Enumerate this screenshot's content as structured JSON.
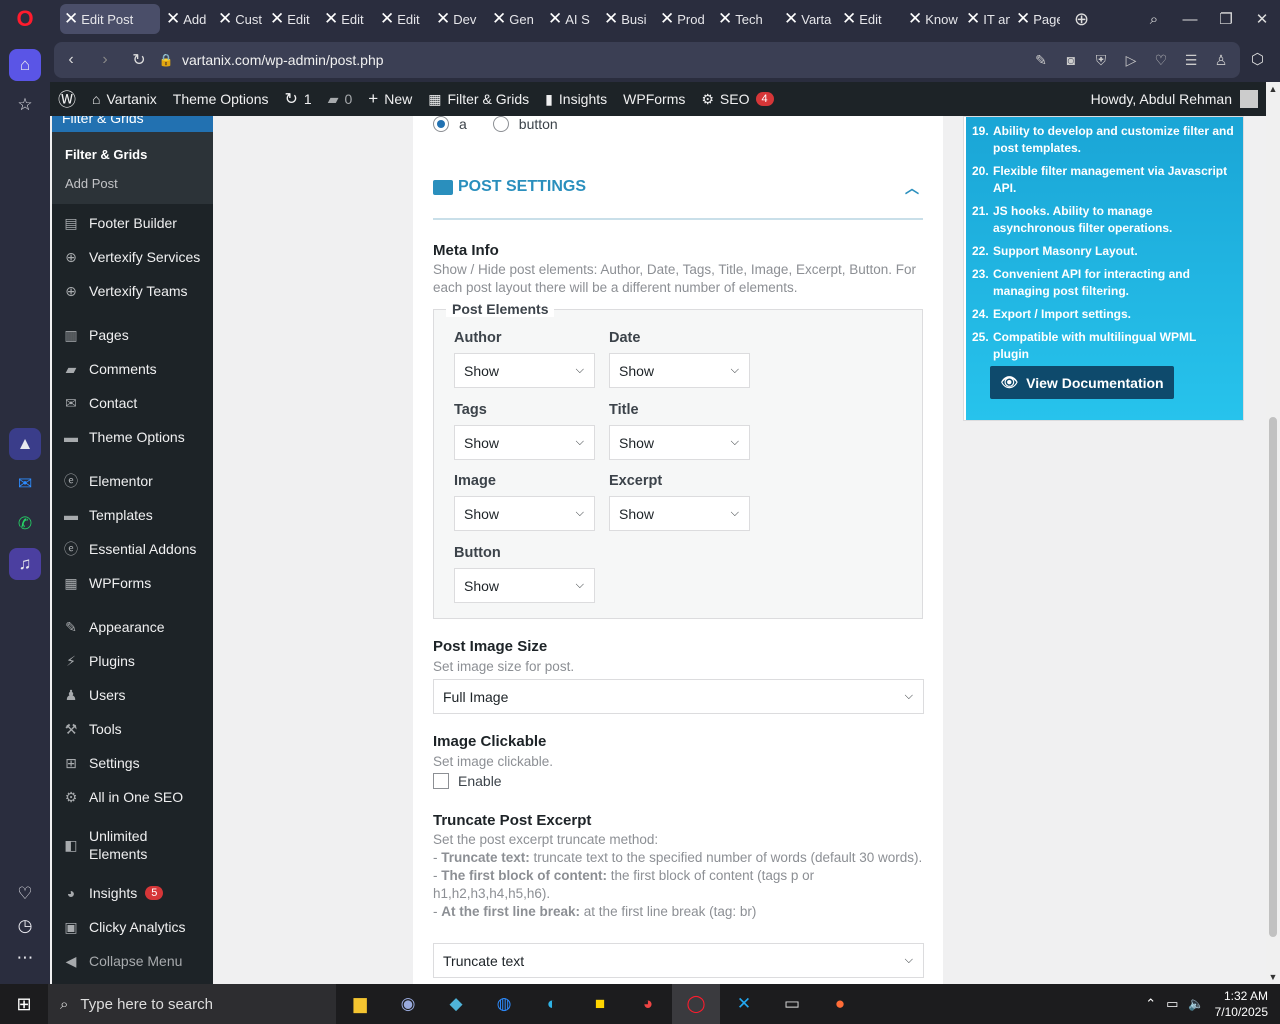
{
  "browser": {
    "tabs": [
      {
        "label": "Edit Post",
        "active": true
      },
      {
        "label": "Add"
      },
      {
        "label": "Cust"
      },
      {
        "label": "Edit"
      },
      {
        "label": "Edit"
      },
      {
        "label": "Edit"
      },
      {
        "label": "Dev"
      },
      {
        "label": "Gen"
      },
      {
        "label": "AI S"
      },
      {
        "label": "Busi"
      },
      {
        "label": "Prod"
      },
      {
        "label": "Tech"
      },
      {
        "label": "Varta"
      },
      {
        "label": "Edit"
      },
      {
        "label": "Know"
      },
      {
        "label": "IT an"
      },
      {
        "label": "Page"
      }
    ],
    "url": "vartanix.com/wp-admin/post.php"
  },
  "adminbar": {
    "site_name": "Vartanix",
    "theme_options": "Theme Options",
    "updates_count": "1",
    "comments_count": "0",
    "new_label": "New",
    "filter_grids": "Filter & Grids",
    "insights": "Insights",
    "wpforms": "WPForms",
    "seo": "SEO",
    "seo_badge": "4",
    "howdy": "Howdy, Abdul Rehman"
  },
  "sidebar": {
    "current_label": "Filter & Grids",
    "submenu": [
      "Filter & Grids",
      "Add Post"
    ],
    "items": [
      {
        "label": "Footer Builder",
        "icon": "list-icon"
      },
      {
        "label": "Vertexify Services",
        "icon": "plus-circle-icon"
      },
      {
        "label": "Vertexify Teams",
        "icon": "plus-circle-icon"
      },
      {
        "label": "Pages",
        "icon": "pages-icon"
      },
      {
        "label": "Comments",
        "icon": "comment-icon"
      },
      {
        "label": "Contact",
        "icon": "mail-icon"
      },
      {
        "label": "Theme Options",
        "icon": "folder-icon"
      },
      {
        "label": "Elementor",
        "icon": "elementor-icon"
      },
      {
        "label": "Templates",
        "icon": "folder-icon"
      },
      {
        "label": "Essential Addons",
        "icon": "ea-icon"
      },
      {
        "label": "WPForms",
        "icon": "form-icon"
      },
      {
        "label": "Appearance",
        "icon": "brush-icon"
      },
      {
        "label": "Plugins",
        "icon": "plug-icon"
      },
      {
        "label": "Users",
        "icon": "user-icon"
      },
      {
        "label": "Tools",
        "icon": "wrench-icon"
      },
      {
        "label": "Settings",
        "icon": "settings-icon"
      },
      {
        "label": "All in One SEO",
        "icon": "seo-icon"
      },
      {
        "label": "Unlimited Elements",
        "icon": "ue-icon"
      },
      {
        "label": "Insights",
        "icon": "insights-icon",
        "badge": "5"
      },
      {
        "label": "Clicky Analytics",
        "icon": "chart-icon"
      },
      {
        "label": "Collapse Menu",
        "icon": "collapse-icon"
      }
    ]
  },
  "radio_options": [
    "a",
    "button"
  ],
  "post_settings": {
    "section_title": "POST SETTINGS",
    "meta_info": {
      "label": "Meta Info",
      "desc": "Show / Hide post elements: Author, Date, Tags, Title, Image, Excerpt, Button. For each post layout there will be a different number of elements."
    },
    "post_elements": {
      "legend": "Post Elements",
      "fields": [
        {
          "label": "Author",
          "value": "Show"
        },
        {
          "label": "Date",
          "value": "Show"
        },
        {
          "label": "Tags",
          "value": "Show"
        },
        {
          "label": "Title",
          "value": "Show"
        },
        {
          "label": "Image",
          "value": "Show"
        },
        {
          "label": "Excerpt",
          "value": "Show"
        },
        {
          "label": "Button",
          "value": "Show"
        }
      ]
    },
    "image_size": {
      "label": "Post Image Size",
      "desc": "Set image size for post.",
      "value": "Full Image"
    },
    "image_clickable": {
      "label": "Image Clickable",
      "desc": "Set image clickable.",
      "checkbox": "Enable"
    },
    "truncate": {
      "label": "Truncate Post Excerpt",
      "desc": "Set the post excerpt truncate method:",
      "opt1_b": "Truncate text:",
      "opt1": "truncate text to the specified number of words (default 30 words).",
      "opt2_b": "The first block of content:",
      "opt2": "the first block of content (tags p or h1,h2,h3,h4,h5,h6).",
      "opt3_b": "At the first line break:",
      "opt3": "at the first line break (tag: br)",
      "value": "Truncate text"
    }
  },
  "promo": {
    "items": [
      {
        "n": "19.",
        "text": "Ability to develop and customize filter and post templates."
      },
      {
        "n": "20.",
        "text": "Flexible filter management via Javascript API."
      },
      {
        "n": "21.",
        "text": "JS hooks. Ability to manage asynchronous filter operations."
      },
      {
        "n": "22.",
        "text": "Support Masonry Layout."
      },
      {
        "n": "23.",
        "text": "Convenient API for interacting and managing post filtering."
      },
      {
        "n": "24.",
        "text": "Export / Import settings."
      },
      {
        "n": "25.",
        "text": "Compatible with multilingual WPML plugin"
      }
    ],
    "button": "View Documentation"
  },
  "taskbar": {
    "search_placeholder": "Type here to search",
    "time": "1:32 AM",
    "date": "7/10/2025"
  },
  "colors": {
    "admin_bg": "#1d2327",
    "accent": "#2271b1",
    "promo": "#1aa5d6",
    "section": "#2a8fbd"
  }
}
